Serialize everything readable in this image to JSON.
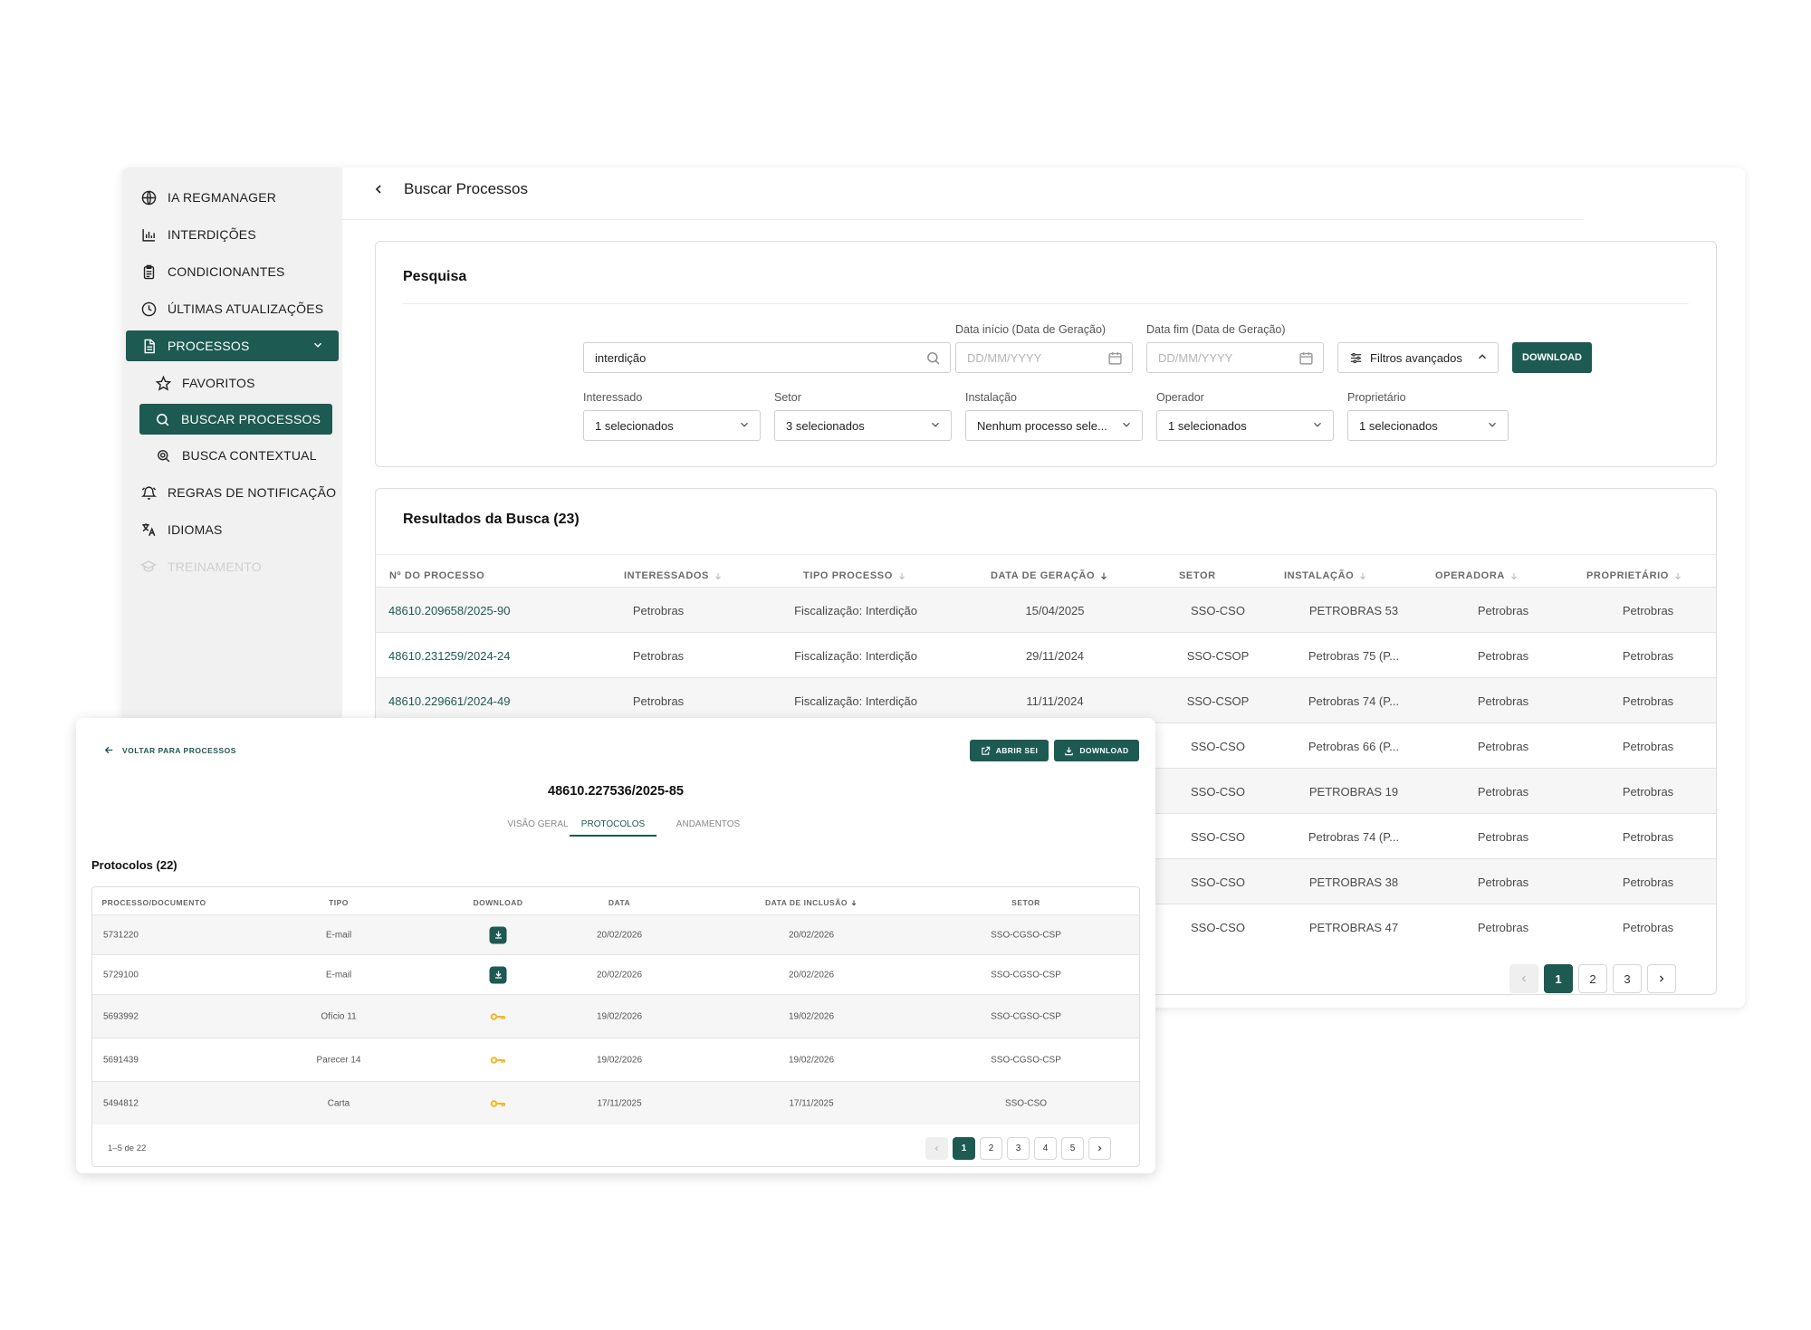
{
  "sidebar": {
    "items": [
      {
        "label": "IA REGMANAGER",
        "icon": "globe-icon"
      },
      {
        "label": "INTERDIÇÕES",
        "icon": "bar-chart-icon"
      },
      {
        "label": "CONDICIONANTES",
        "icon": "clipboard-icon"
      },
      {
        "label": "ÚLTIMAS ATUALIZAÇÕES",
        "icon": "clock-icon"
      },
      {
        "label": "PROCESSOS",
        "icon": "document-icon",
        "expanded": true
      },
      {
        "label": "FAVORITOS",
        "icon": "star-icon"
      },
      {
        "label": "BUSCAR PROCESSOS",
        "icon": "search-icon",
        "active": true
      },
      {
        "label": "BUSCA CONTEXTUAL",
        "icon": "zoom-search-icon"
      },
      {
        "label": "REGRAS DE NOTIFICAÇÃO",
        "icon": "bell-icon"
      },
      {
        "label": "IDIOMAS",
        "icon": "translate-icon"
      },
      {
        "label": "TREINAMENTO",
        "icon": "graduation-cap-icon",
        "disabled": true
      }
    ]
  },
  "header": {
    "title": "Buscar Processos"
  },
  "search": {
    "title": "Pesquisa",
    "query": "interdição",
    "date_start_label": "Data início (Data de Geração)",
    "date_end_label": "Data fim (Data de Geração)",
    "date_placeholder": "DD/MM/YYYY",
    "advanced_filters_label": "Filtros avançados",
    "download_label": "DOWNLOAD",
    "filters": [
      {
        "label": "Interessado",
        "value": "1 selecionados"
      },
      {
        "label": "Setor",
        "value": "3 selecionados"
      },
      {
        "label": "Instalação",
        "value": "Nenhum processo sele..."
      },
      {
        "label": "Operador",
        "value": "1 selecionados"
      },
      {
        "label": "Proprietário",
        "value": "1 selecionados"
      }
    ]
  },
  "results": {
    "title": "Resultados da Busca (23)",
    "columns": [
      "Nº DO PROCESSO",
      "INTERESSADOS",
      "TIPO PROCESSO",
      "DATA DE GERAÇÃO",
      "SETOR",
      "INSTALAÇÃO",
      "OPERADORA",
      "PROPRIETÁRIO"
    ],
    "rows": [
      [
        "48610.209658/2025-90",
        "Petrobras",
        "Fiscalização: Interdição",
        "15/04/2025",
        "SSO-CSO",
        "PETROBRAS 53",
        "Petrobras",
        "Petrobras"
      ],
      [
        "48610.231259/2024-24",
        "Petrobras",
        "Fiscalização: Interdição",
        "29/11/2024",
        "SSO-CSOP",
        "Petrobras 75 (P...",
        "Petrobras",
        "Petrobras"
      ],
      [
        "48610.229661/2024-49",
        "Petrobras",
        "Fiscalização: Interdição",
        "11/11/2024",
        "SSO-CSOP",
        "Petrobras 74 (P...",
        "Petrobras",
        "Petrobras"
      ],
      [
        "",
        "",
        "",
        "",
        "SSO-CSO",
        "Petrobras 66 (P...",
        "Petrobras",
        "Petrobras"
      ],
      [
        "",
        "",
        "",
        "",
        "SSO-CSO",
        "PETROBRAS 19",
        "Petrobras",
        "Petrobras"
      ],
      [
        "",
        "",
        "",
        "",
        "SSO-CSO",
        "Petrobras 74 (P...",
        "Petrobras",
        "Petrobras"
      ],
      [
        "",
        "",
        "",
        "",
        "SSO-CSO",
        "PETROBRAS 38",
        "Petrobras",
        "Petrobras"
      ],
      [
        "",
        "",
        "",
        "",
        "SSO-CSO",
        "PETROBRAS 47",
        "Petrobras",
        "Petrobras"
      ]
    ],
    "pagination": {
      "pages": [
        "1",
        "2",
        "3"
      ],
      "current": "1"
    }
  },
  "detail": {
    "back_label": "VOLTAR PARA PROCESSOS",
    "open_sei_label": "ABRIR SEI",
    "download_label": "DOWNLOAD",
    "process_number": "48610.227536/2025-85",
    "tabs": [
      "VISÃO GERAL",
      "PROTOCOLOS",
      "ANDAMENTOS"
    ],
    "active_tab": "PROTOCOLOS",
    "protocols_title": "Protocolos (22)",
    "columns": [
      "PROCESSO/DOCUMENTO",
      "TIPO",
      "DOWNLOAD",
      "DATA",
      "DATA DE INCLUSÃO",
      "SETOR"
    ],
    "rows": [
      {
        "doc": "5731220",
        "tipo": "E-mail",
        "download": "download-icon",
        "data": "20/02/2026",
        "inclusao": "20/02/2026",
        "setor": "SSO-CGSO-CSP"
      },
      {
        "doc": "5729100",
        "tipo": "E-mail",
        "download": "download-icon",
        "data": "20/02/2026",
        "inclusao": "20/02/2026",
        "setor": "SSO-CGSO-CSP"
      },
      {
        "doc": "5693992",
        "tipo": "Ofício 11",
        "download": "key-icon",
        "data": "19/02/2026",
        "inclusao": "19/02/2026",
        "setor": "SSO-CGSO-CSP"
      },
      {
        "doc": "5691439",
        "tipo": "Parecer 14",
        "download": "key-icon",
        "data": "19/02/2026",
        "inclusao": "19/02/2026",
        "setor": "SSO-CGSO-CSP"
      },
      {
        "doc": "5494812",
        "tipo": "Carta",
        "download": "key-icon",
        "data": "17/11/2025",
        "inclusao": "17/11/2025",
        "setor": "SSO-CSO"
      }
    ],
    "range_label": "1–5 de 22",
    "pagination": {
      "pages": [
        "1",
        "2",
        "3",
        "4",
        "5"
      ],
      "current": "1"
    }
  },
  "colors": {
    "accent": "#1d5a52",
    "key": "#f2b81f",
    "sidebar_bg": "#f1f1f1"
  }
}
